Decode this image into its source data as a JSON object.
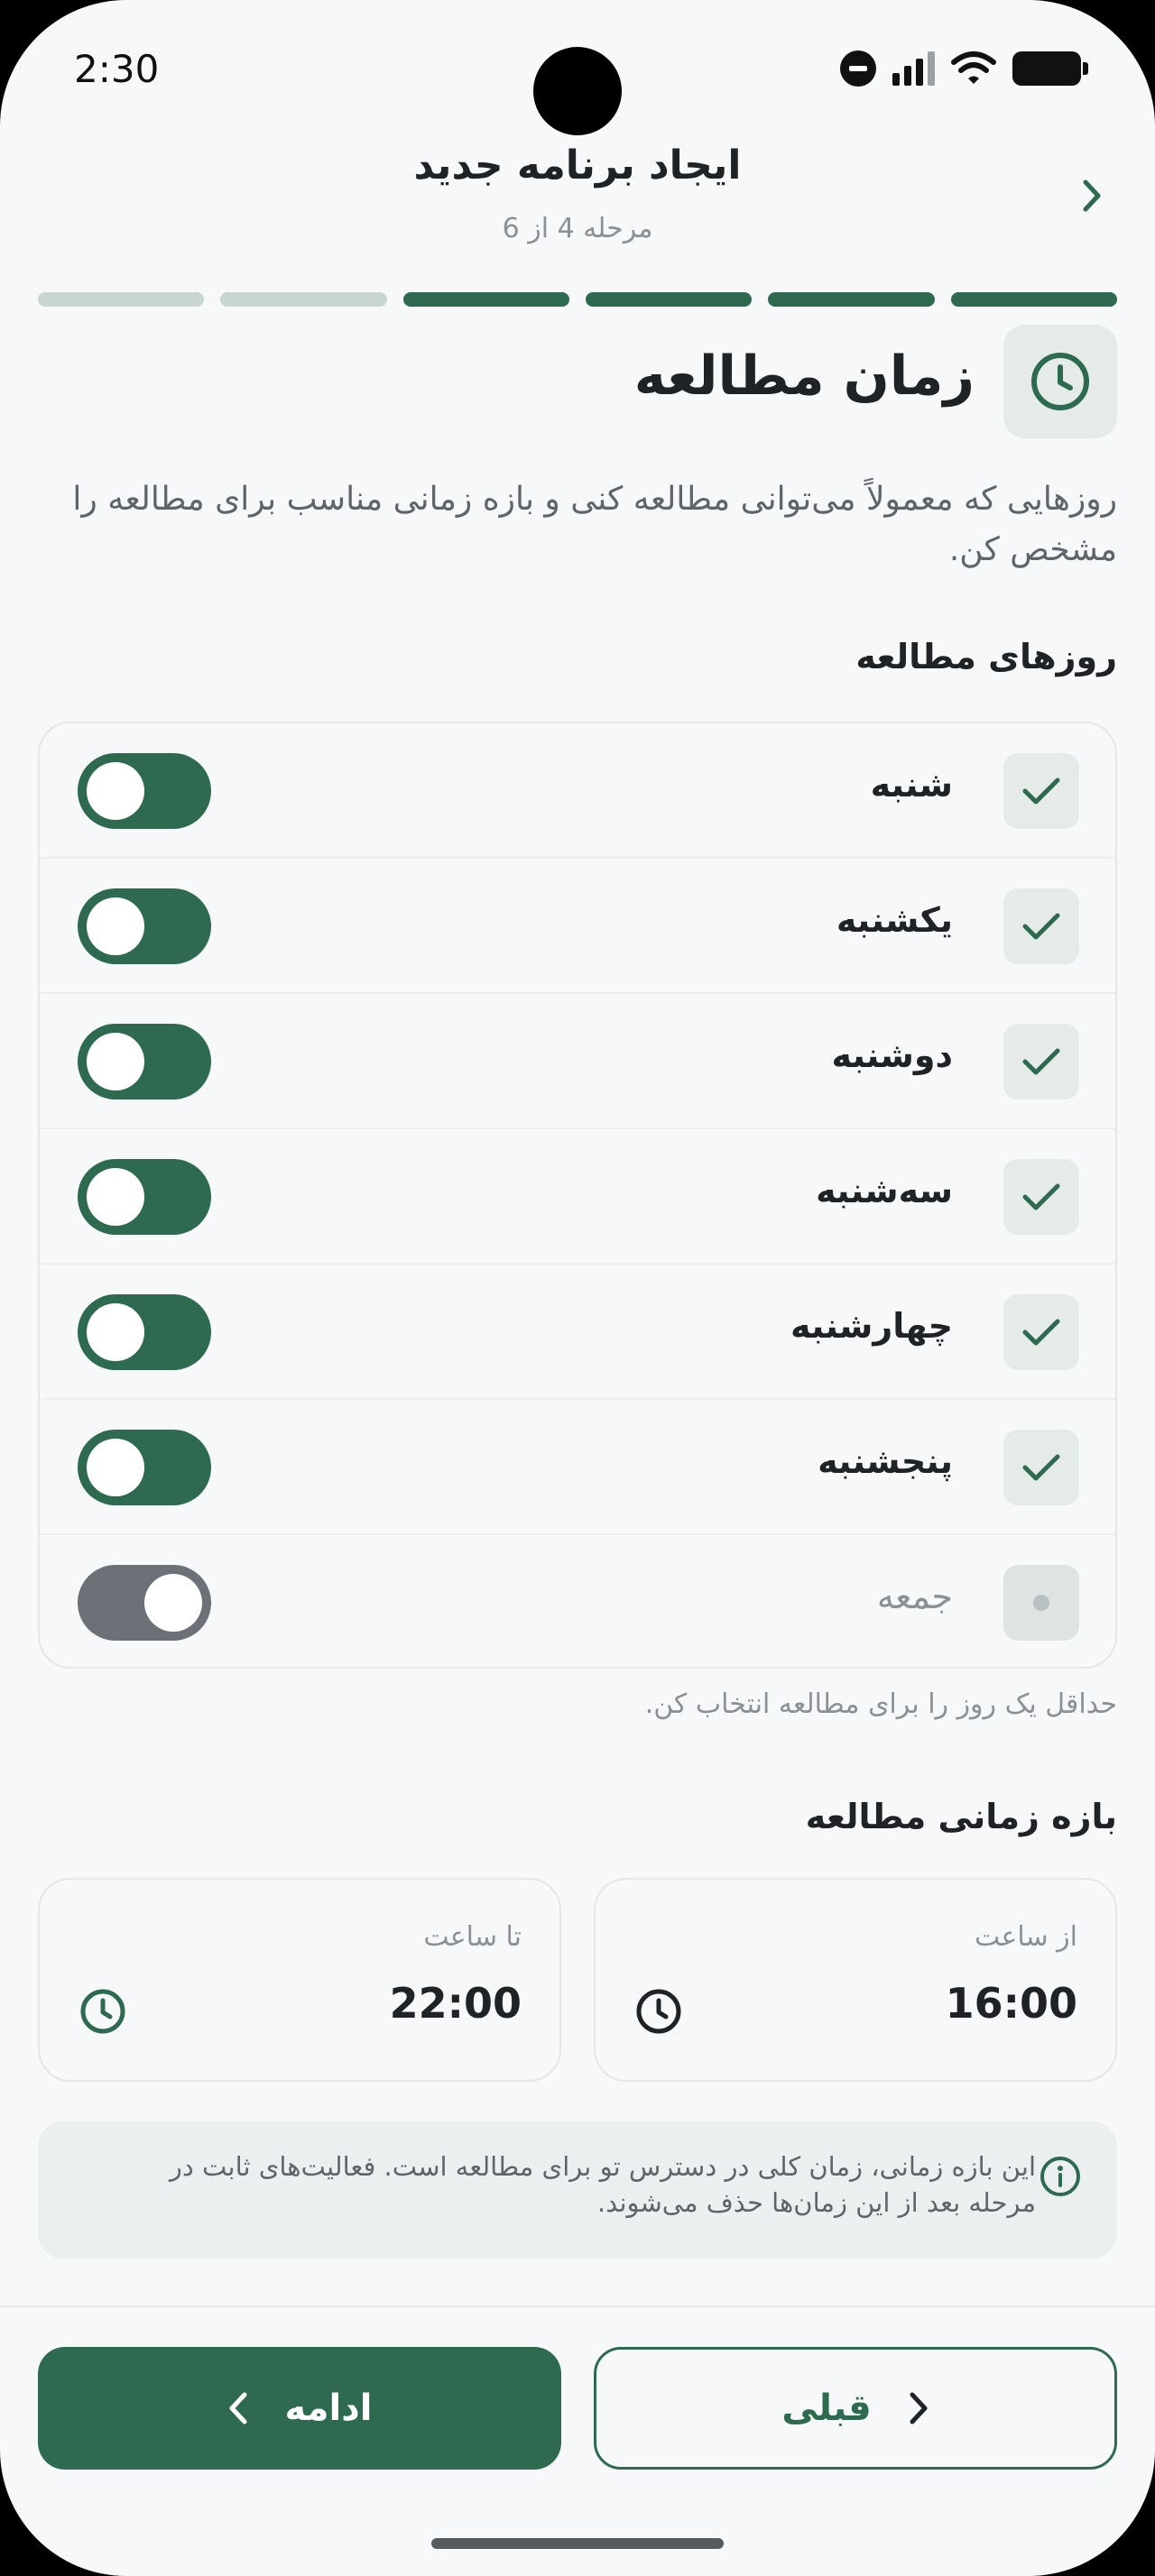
{
  "status_bar": {
    "time": "2:30"
  },
  "header": {
    "title": "ایجاد برنامه جدید",
    "step": "مرحله 4 از 6"
  },
  "progress": {
    "total_steps": 6,
    "completed_steps": 4,
    "active_color": "#2d6a4f",
    "inactive_color": "#c8d5d0"
  },
  "section": {
    "icon": "clock-icon",
    "title": "زمان مطالعه",
    "description": "روزهایی که معمولاً می‌توانی مطالعه کنی و بازه زمانی مناسب برای مطالعه را مشخص کن."
  },
  "days": {
    "heading": "روزهای مطالعه",
    "items": [
      {
        "label": "شنبه",
        "enabled": true
      },
      {
        "label": "یکشنبه",
        "enabled": true
      },
      {
        "label": "دوشنبه",
        "enabled": true
      },
      {
        "label": "سه‌شنبه",
        "enabled": true
      },
      {
        "label": "چهارشنبه",
        "enabled": true
      },
      {
        "label": "پنجشنبه",
        "enabled": true
      },
      {
        "label": "جمعه",
        "enabled": false
      }
    ],
    "hint": "حداقل یک روز را برای مطالعه انتخاب کن."
  },
  "time_range": {
    "heading": "بازه زمانی مطالعه",
    "from": {
      "label": "از ساعت",
      "value": "16:00"
    },
    "to": {
      "label": "تا ساعت",
      "value": "22:00"
    }
  },
  "info_note": {
    "text": "این بازه زمانی، زمان کلی در دسترس تو برای مطالعه است. فعالیت‌های ثابت در مرحله بعد از این زمان‌ها حذف می‌شوند."
  },
  "footer": {
    "prev_label": "قبلی",
    "next_label": "ادامه"
  },
  "colors": {
    "accent": "#2d6a4f",
    "toggle_off": "#6b7177",
    "background": "#f6f8f9"
  }
}
